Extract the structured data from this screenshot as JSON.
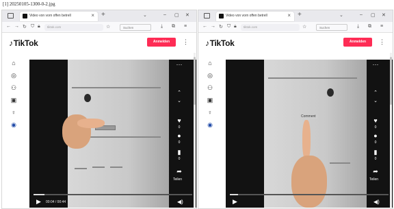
{
  "caption": "[1] 20250105-1300-0-2.jpg",
  "left": {
    "tab_title": "Video von vorn offen betrell",
    "url": "tiktok.com",
    "search_placeholder": "Suchen",
    "logo": "TikTok",
    "login_label": "Anmelden",
    "time": "00:04 / 00:44",
    "share_label": "Teilen",
    "slot_label": "",
    "counts": [
      "0",
      "0",
      "0"
    ]
  },
  "right": {
    "tab_title": "Video von vorn offen betrell",
    "url": "tiktok.com",
    "search_placeholder": "Suchen",
    "logo": "TikTok",
    "login_label": "Anmelden",
    "time": "",
    "share_label": "Teilen",
    "slot_label": "Comment",
    "counts": [
      "0",
      "0",
      "0"
    ]
  },
  "icons": {
    "tab_close": "×",
    "new_tab": "+",
    "kebab": "⋮",
    "more": "···",
    "play": "▶",
    "volume": "◀)",
    "home": "⌂",
    "explore": "◎",
    "following": "⚇",
    "live": "▣",
    "profile_person": "♀",
    "profile": "◉",
    "heart": "♥",
    "comment": "●",
    "bookmark": "▮",
    "share": "➦",
    "up": "⌃",
    "down": "⌄"
  },
  "colors": {
    "accent": "#fe2c55",
    "profile": "#1f4aa8"
  }
}
